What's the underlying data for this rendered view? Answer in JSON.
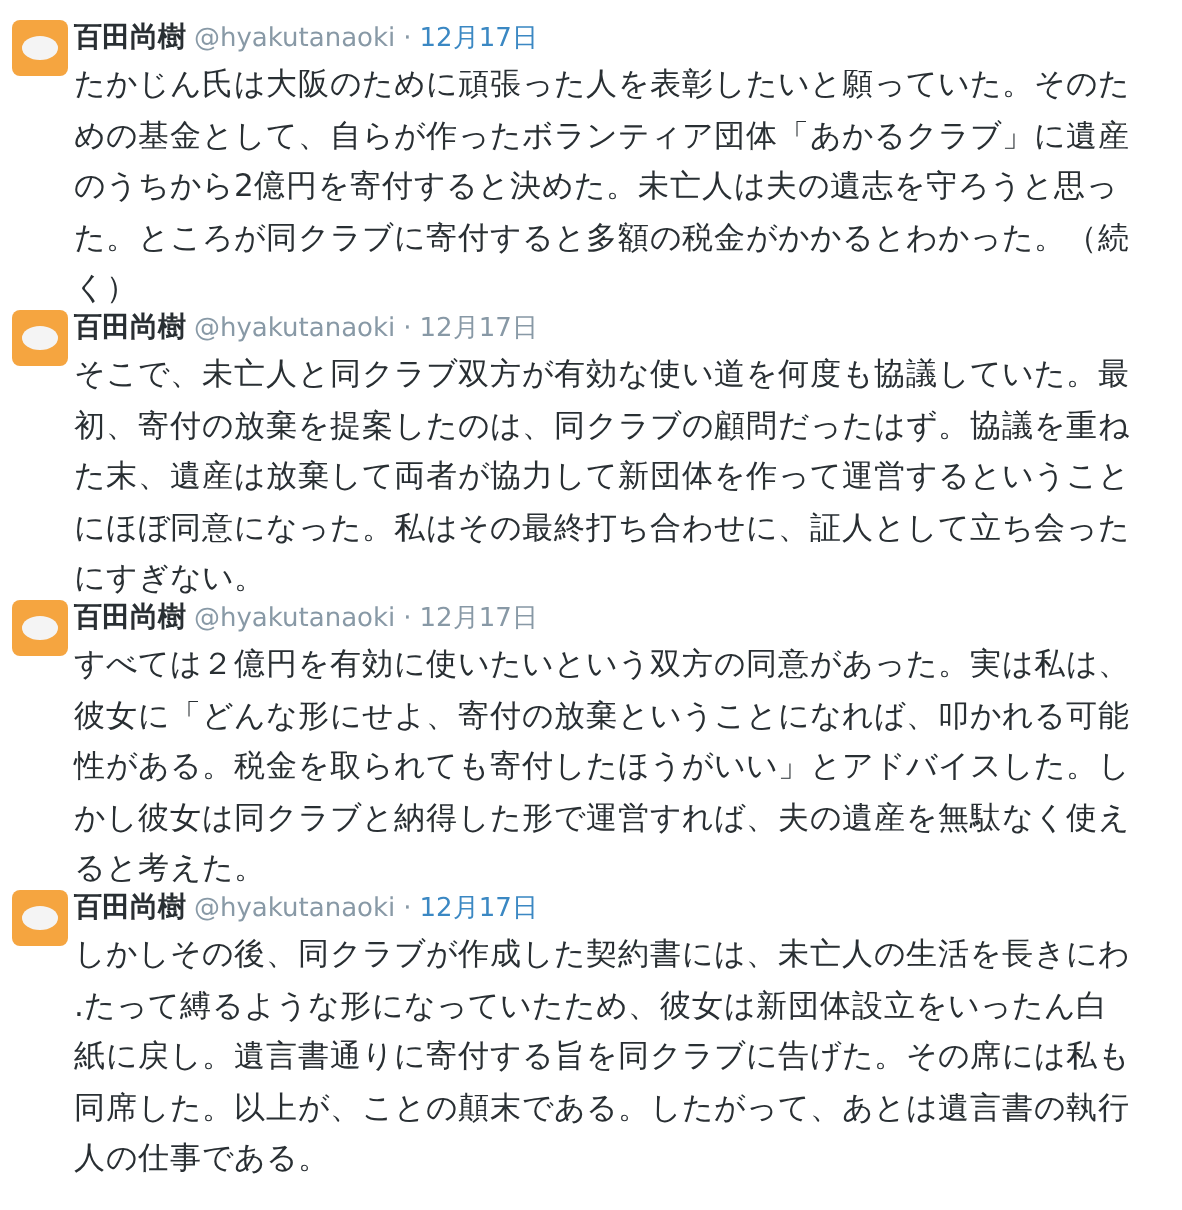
{
  "tweets": [
    {
      "name": "百田尚樹",
      "handle": "@hyakutanaoki",
      "separator": "·",
      "date": "12月17日",
      "date_highlighted": true,
      "text": "たかじん氏は大阪のために頑張った人を表彰したいと願っていた。そのための基金として、自らが作ったボランティア団体「あかるクラブ」に遺産のうちから2億円を寄付すると決めた。未亡人は夫の遺志を守ろうと思った。ところが同クラブに寄付すると多額の税金がかかるとわかった。（続く）"
    },
    {
      "name": "百田尚樹",
      "handle": "@hyakutanaoki",
      "separator": "·",
      "date": "12月17日",
      "date_highlighted": false,
      "text": "そこで、未亡人と同クラブ双方が有効な使い道を何度も協議していた。最初、寄付の放棄を提案したのは、同クラブの顧問だったはず。協議を重ねた末、遺産は放棄して両者が協力して新団体を作って運営するということにほぼ同意になった。私はその最終打ち合わせに、証人として立ち会ったにすぎない。"
    },
    {
      "name": "百田尚樹",
      "handle": "@hyakutanaoki",
      "separator": "·",
      "date": "12月17日",
      "date_highlighted": false,
      "text": "すべては２億円を有効に使いたいという双方の同意があった。実は私は、彼女に「どんな形にせよ、寄付の放棄ということになれば、叩かれる可能性がある。税金を取られても寄付したほうがいい」とアドバイスした。しかし彼女は同クラブと納得した形で運営すれば、夫の遺産を無駄なく使えると考えた。"
    },
    {
      "name": "百田尚樹",
      "handle": "@hyakutanaoki",
      "separator": "·",
      "date": "12月17日",
      "date_highlighted": true,
      "text": "しかしその後、同クラブが作成した契約書には、未亡人の生活を長きにわ .たって縛るような形になっていたため、彼女は新団体設立をいったん白紙に戻し。遺言書通りに寄付する旨を同クラブに告げた。その席には私も同席した。以上が、ことの顛末である。したがって、あとは遺言書の執行人の仕事である。"
    }
  ]
}
